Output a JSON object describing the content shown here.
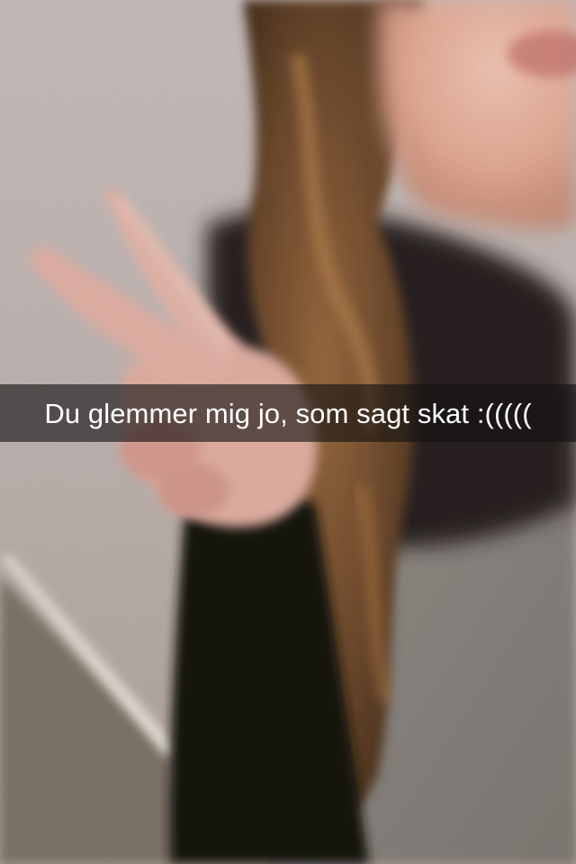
{
  "caption": {
    "text": "Du glemmer mig jo, som sagt skat :((((("
  },
  "colors": {
    "caption_bar": "#141212",
    "caption_text": "#ffffff",
    "wall": "#c9bfbb",
    "hair": "#6b4a2c",
    "skin": "#e7b7a6",
    "sweater": "#8f8a86",
    "sleeve": "#151412"
  }
}
